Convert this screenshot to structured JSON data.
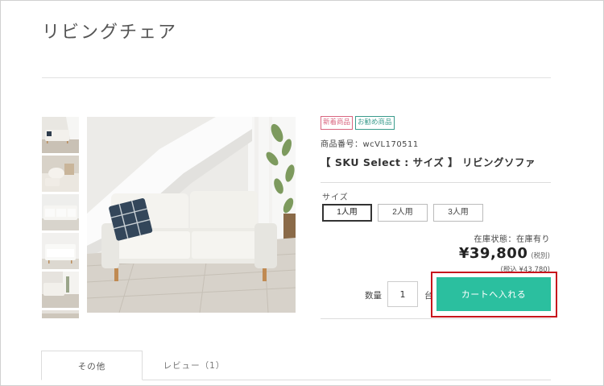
{
  "page": {
    "title": "リビングチェア"
  },
  "product": {
    "badges": [
      {
        "label": "新着商品",
        "color": "#d9657f"
      },
      {
        "label": "お勧め商品",
        "color": "#3a9b8c"
      }
    ],
    "code": "商品番号：wcVL170511",
    "name": "【 SKU Select : サイズ 】 リビングソファ",
    "size_label": "サイズ",
    "size_options": [
      {
        "label": "1人用",
        "selected": true
      },
      {
        "label": "2人用",
        "selected": false
      },
      {
        "label": "3人用",
        "selected": false
      }
    ],
    "stock": "在庫状態：在庫有り",
    "price": "¥39,800",
    "price_tax_note": "(税別)",
    "price_incl": "(税込 ¥43,780)",
    "quantity_label": "数量",
    "quantity_value": "1",
    "unit_label": "台",
    "cart_button": "カートへ入れる"
  },
  "tabs": [
    {
      "label": "その他",
      "active": true
    },
    {
      "label": "レビュー（1）",
      "active": false
    }
  ],
  "colors": {
    "cart_button": "#2bbf9f",
    "highlight": "#c8161d",
    "badge_new": "#d9657f",
    "badge_recommended": "#3a9b8c"
  }
}
